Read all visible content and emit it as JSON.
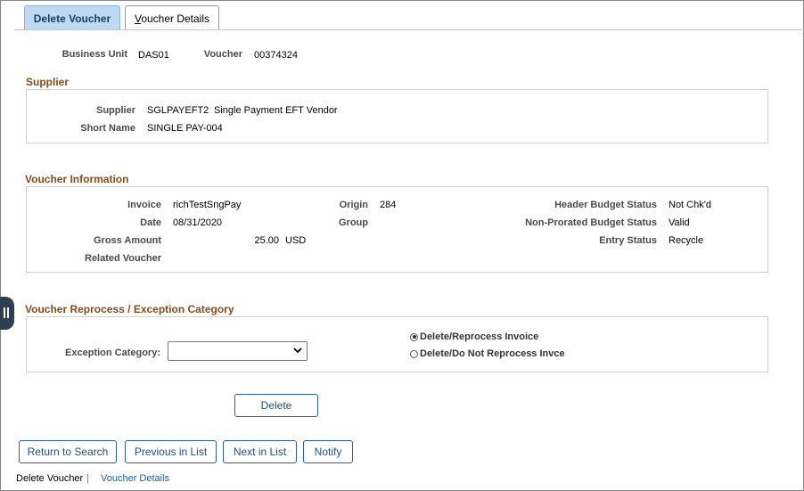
{
  "tabs": [
    {
      "label": "Delete Voucher",
      "active": true
    },
    {
      "label_first": "V",
      "label_rest": "oucher Details",
      "active": false
    }
  ],
  "header": {
    "business_unit_label": "Business Unit",
    "business_unit_value": "DAS01",
    "voucher_label": "Voucher",
    "voucher_value": "00374324"
  },
  "supplier": {
    "title": "Supplier",
    "supplier_label": "Supplier",
    "supplier_id": "SGLPAYEFT2",
    "supplier_name": "Single Payment EFT Vendor",
    "short_name_label": "Short Name",
    "short_name_value": "SINGLE PAY-004"
  },
  "voucher_info": {
    "title": "Voucher Information",
    "invoice_label": "Invoice",
    "invoice_value": "richTestSngPay",
    "date_label": "Date",
    "date_value": "08/31/2020",
    "gross_label": "Gross Amount",
    "gross_value": "25.00",
    "gross_currency": "USD",
    "related_label": "Related Voucher",
    "origin_label": "Origin",
    "origin_value": "284",
    "group_label": "Group",
    "header_budget_label": "Header Budget Status",
    "header_budget_value": "Not Chk'd",
    "nonprorated_label": "Non-Prorated Budget Status",
    "nonprorated_value": "Valid",
    "entry_status_label": "Entry Status",
    "entry_status_value": "Recycle"
  },
  "reprocess": {
    "title": "Voucher Reprocess / Exception Category",
    "exception_label": "Exception Category:",
    "exception_value": "",
    "radio_options": [
      {
        "label": "Delete/Reprocess Invoice",
        "selected": true
      },
      {
        "label": "Delete/Do Not Reprocess Invce",
        "selected": false
      }
    ]
  },
  "actions": {
    "delete_label": "Delete"
  },
  "bottom_buttons": {
    "return_label": "Return to Search",
    "previous_label": "Previous in List",
    "next_label": "Next in List",
    "notify_label": "Notify"
  },
  "footer": {
    "current": "Delete Voucher",
    "separator": "|",
    "link": "Voucher Details"
  },
  "icons": {
    "chevron": "chevron-down-icon",
    "side": "sidebar-toggle-icon"
  },
  "colors": {
    "active_tab_bg": "#bfd9f2",
    "section_title": "#8b4a1a",
    "button_text": "#1f4e8c"
  }
}
